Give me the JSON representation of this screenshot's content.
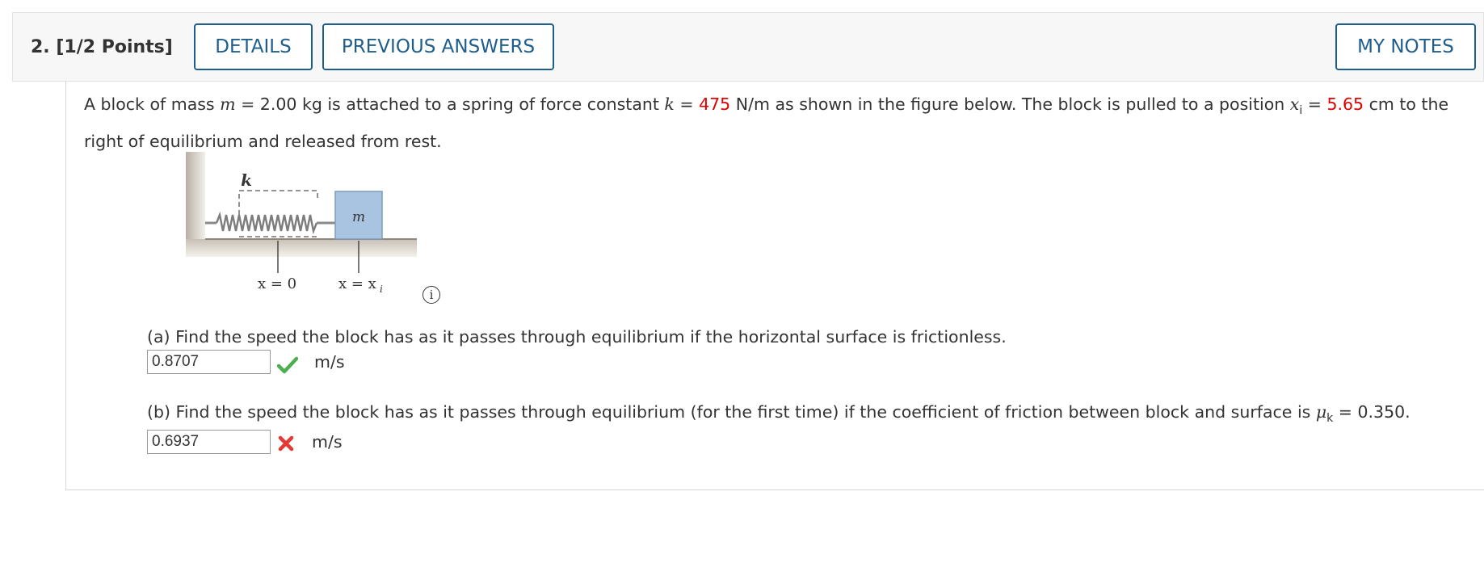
{
  "question": {
    "number_label": "2.",
    "points_label": "[1/2 Points]",
    "details_button": "DETAILS",
    "previous_answers_button": "PREVIOUS ANSWERS",
    "my_notes_button": "MY NOTES"
  },
  "problem": {
    "t1": "A block of mass ",
    "m_var": "m",
    "t2": " = 2.00 kg is attached to a spring of force constant ",
    "k_var": "k",
    "t3": " = ",
    "k_value": "475",
    "t4": " N/m as shown in the figure below. The block is pulled to a position ",
    "x_var": "x",
    "x_sub": "i",
    "t5": " = ",
    "x_value": "5.65",
    "t6": " cm to the right of equilibrium and released from rest."
  },
  "figure": {
    "spring_label": "k",
    "mass_label": "m",
    "x0_label": "x = 0",
    "xi_label": "x = x",
    "xi_sub": "i",
    "info_icon": "info-icon"
  },
  "part_a": {
    "question": "(a) Find the speed the block has as it passes through equilibrium if the horizontal surface is frictionless.",
    "answer": "0.8707",
    "unit": "m/s",
    "status_icon": "check-icon",
    "status_color": "#4caf50"
  },
  "part_b": {
    "q1": "(b) Find the speed the block has as it passes through equilibrium (for the first time) if the coefficient of friction between block and surface is ",
    "mu_var": "μ",
    "mu_sub": "k",
    "q2": " = 0.350.",
    "answer": "0.6937",
    "unit": "m/s",
    "status_icon": "cross-icon",
    "status_color": "#e53935"
  },
  "colors": {
    "accent": "#1f5e8c",
    "highlight": "#e10000",
    "block_fill": "#a9c4e0"
  }
}
